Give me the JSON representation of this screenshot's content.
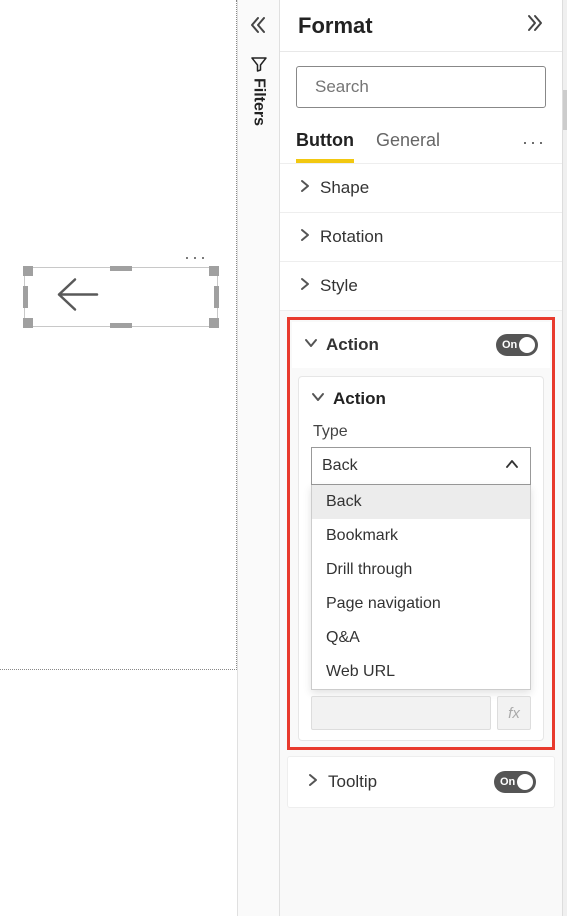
{
  "canvas": {
    "more": "···"
  },
  "filters": {
    "label": "Filters"
  },
  "format": {
    "title": "Format",
    "search": {
      "placeholder": "Search"
    },
    "tabs": {
      "button": "Button",
      "general": "General",
      "more": "···"
    },
    "sections": {
      "shape": "Shape",
      "rotation": "Rotation",
      "style": "Style",
      "action": "Action",
      "tooltip": "Tooltip"
    },
    "toggle": {
      "on": "On"
    },
    "action_card": {
      "header": "Action",
      "type_label": "Type",
      "selected": "Back",
      "options": [
        "Back",
        "Bookmark",
        "Drill through",
        "Page navigation",
        "Q&A",
        "Web URL"
      ],
      "fx": "fx"
    }
  }
}
